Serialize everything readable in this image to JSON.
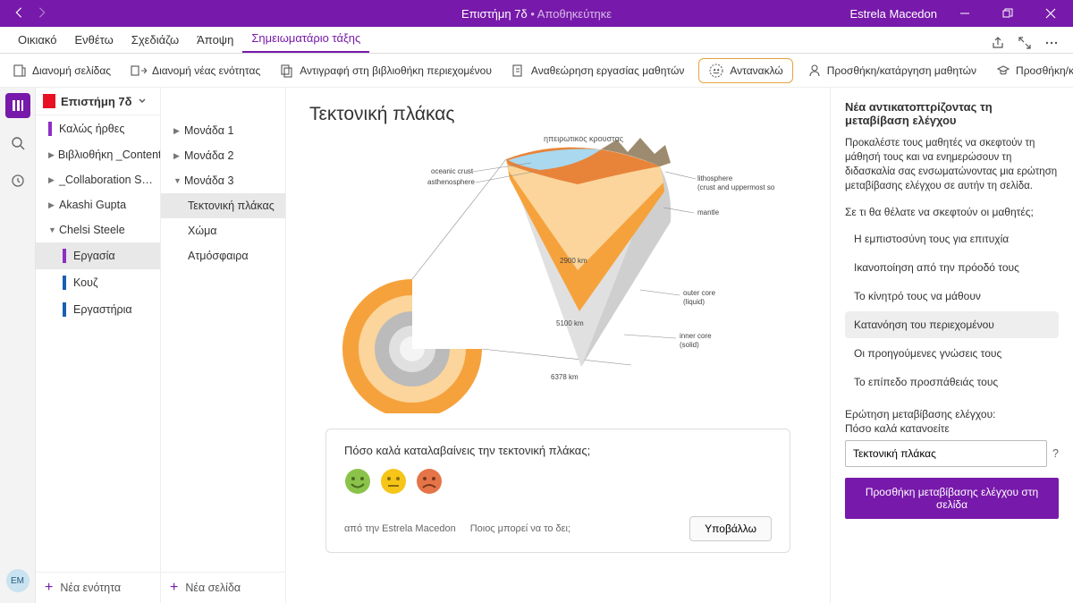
{
  "titlebar": {
    "docTitle": "Επιστήμη 7δ",
    "saved": "• Αποθηκεύτηκε",
    "user": "Estrela Macedon",
    "avatar": "EM"
  },
  "tabs": {
    "home": "Οικιακό",
    "insert": "Ενθέτω",
    "draw": "Σχεδιάζω",
    "view": "Άποψη",
    "classNotebook": "Σημειωματάριο τάξης"
  },
  "ribbon": {
    "distributePage": "Διανομή σελίδας",
    "distributeSection": "Διανομή νέας ενότητας",
    "copyContent": "Αντιγραφή στη βιβλιοθήκη περιεχομένου",
    "reviewWork": "Αναθεώρηση εργασίας μαθητών",
    "reflect": "Αντανακλώ",
    "addStudents": "Προσθήκη/κατάργηση μαθητών",
    "addTeachers": "Προσθήκη/κατάργηση δασκάλων"
  },
  "notebook": {
    "title": "Επιστήμη 7δ"
  },
  "nav1": {
    "items": [
      {
        "label": "Καλώς ήρθες",
        "kind": "tag-purple"
      },
      {
        "label": "Βιβλιοθήκη _Content",
        "kind": "chev"
      },
      {
        "label": "_Collaboration S…",
        "kind": "chev"
      },
      {
        "label": "Akashi Gupta",
        "kind": "chev"
      },
      {
        "label": "Chelsi Steele",
        "kind": "chev-open"
      },
      {
        "label": "Εργασία",
        "kind": "tag-purple",
        "indent": true,
        "selected": true
      },
      {
        "label": "Κουζ",
        "kind": "tag-blue",
        "indent": true
      },
      {
        "label": "Εργαστήρια",
        "kind": "tag-blue",
        "indent": true
      }
    ],
    "add": "Νέα ενότητα"
  },
  "nav2": {
    "items": [
      {
        "label": "Μονάδα 1",
        "kind": "chev"
      },
      {
        "label": "Μονάδα 2",
        "kind": "chev"
      },
      {
        "label": "Μονάδα 3",
        "kind": "chev-open"
      },
      {
        "label": "Τεκτονική πλάκας",
        "indent": true,
        "selected": true
      },
      {
        "label": "Χώμα",
        "indent": true
      },
      {
        "label": "Ατμόσφαιρα",
        "indent": true
      }
    ],
    "add": "Νέα σελίδα"
  },
  "page": {
    "title": "Τεκτονική πλάκας"
  },
  "diagramLabels": {
    "topGreek": "ηπειρωτικός κρούστας",
    "oceanicCrust": "oceanic crust",
    "asthenosphere": "asthenosphere",
    "lithosphere": "lithosphere",
    "lithosphereSub": "(crust and uppermost solid mantle)",
    "mantle": "mantle",
    "d2900": "2900 km",
    "outerCore": "outer core",
    "outerCoreSub": "(liquid)",
    "d5100": "5100 km",
    "innerCore": "inner core",
    "innerCoreSub": "(solid)",
    "d6378": "6378 km"
  },
  "poll": {
    "question": "Πόσο καλά καταλαβαίνεις την τεκτονική πλάκας;",
    "from": "από την Estrela Macedon",
    "whoCanSee": "Ποιος μπορεί να το δει;",
    "submit": "Υποβάλλω"
  },
  "rpanel": {
    "title": "Νέα αντικατοπτρίζοντας τη μεταβίβαση ελέγχου",
    "desc": "Προκαλέστε τους μαθητές να σκεφτούν τη μάθησή τους και να ενημερώσουν τη διδασκαλία σας ενσωματώνοντας μια ερώτηση μεταβίβασης ελέγχου σε αυτήν τη σελίδα.",
    "subhead": "Σε τι θα θέλατε να σκεφτούν οι μαθητές;",
    "choices": [
      "Η εμπιστοσύνη τους για επιτυχία",
      "Ικανοποίηση από την πρόοδό τους",
      "Το κίνητρό τους να μάθουν",
      "Κατανόηση του περιεχομένου",
      "Οι προηγούμενες γνώσεις τους",
      "Το επίπεδο προσπάθειάς τους"
    ],
    "selectedChoice": 3,
    "fieldLabel": "Ερώτηση μεταβίβασης ελέγχου:",
    "fieldSub": "Πόσο καλά κατανοείτε",
    "fieldValue": "Τεκτονική πλάκας",
    "help": "?",
    "addBtn": "Προσθήκη μεταβίβασης ελέγχου στη σελίδα"
  }
}
